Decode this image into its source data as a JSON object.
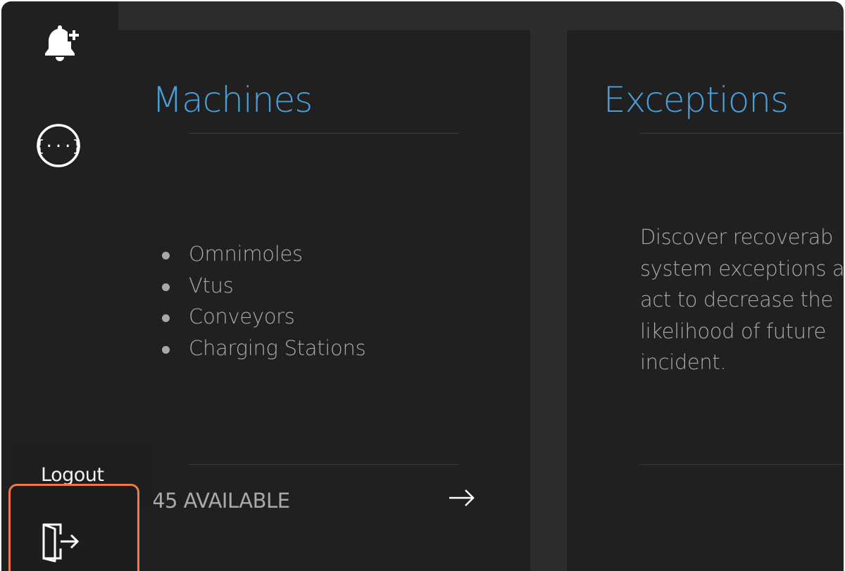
{
  "sidebar": {
    "icons": [
      {
        "name": "bell-plus-icon"
      },
      {
        "name": "api-braces-icon"
      }
    ],
    "logout": {
      "tooltip_label": "Logout",
      "icon": "logout-door-icon",
      "highlight_color": "#ec7a4c"
    }
  },
  "cards": {
    "machines": {
      "title": "Machines",
      "items": [
        "Omnimoles",
        "Vtus",
        "Conveyors",
        "Charging Stations"
      ],
      "available": "45 AVAILABLE",
      "action_icon": "arrow-right-icon"
    },
    "exceptions": {
      "title": "Exceptions",
      "description": "Discover recoverab\nsystem exceptions a\nact to decrease the\nlikelihood of future\nincident."
    }
  },
  "colors": {
    "accent": "#4a9fd8",
    "background": "#2c2c2c",
    "card": "#202020",
    "text_muted": "#a9a9a9"
  }
}
